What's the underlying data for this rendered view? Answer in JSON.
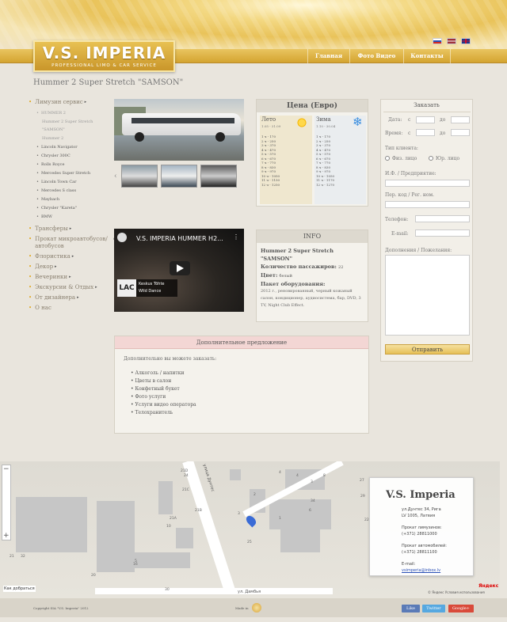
{
  "header": {
    "logo_title": "V.S. IMPERIA",
    "logo_subtitle": "PROFESSIONAL LIMO & CAR SERVICE",
    "nav": [
      "Главная",
      "Фото Видео",
      "Контакты"
    ],
    "languages": [
      "ru",
      "lv",
      "en"
    ]
  },
  "page": {
    "title": "Hummer 2 Super Stretch \"SAMSON\""
  },
  "sidebar": {
    "items": [
      {
        "label": "Лимузин сервис",
        "has_arrow": true
      },
      {
        "label": "Трансферы",
        "has_arrow": true
      },
      {
        "label": "Прокат микроавтобусов/автобусов",
        "has_arrow": true
      },
      {
        "label": "Флористика",
        "has_arrow": true
      },
      {
        "label": "Декор",
        "has_arrow": true
      },
      {
        "label": "Вечеринки",
        "has_arrow": true
      },
      {
        "label": "Экскурсии & Отдых",
        "has_arrow": true
      },
      {
        "label": "От дизайнера",
        "has_arrow": true
      },
      {
        "label": "О нас",
        "has_arrow": false
      }
    ],
    "subitems": [
      {
        "label": "HUMMER 2",
        "active": true
      },
      {
        "label": "Hummer 2 Super Stretch \"SAMSON\"",
        "active": true
      },
      {
        "label": "Hummer 2",
        "active": true
      },
      {
        "label": "Lincoln Navigator",
        "active": false
      },
      {
        "label": "Chrysler 300C",
        "active": false
      },
      {
        "label": "Rolls Royce",
        "active": false
      },
      {
        "label": "Mercedes Super Stretch",
        "active": false
      },
      {
        "label": "Lincoln Town Car",
        "active": false
      },
      {
        "label": "Mercedes S class",
        "active": false
      },
      {
        "label": "Maybach",
        "active": false
      },
      {
        "label": "Chrysler \"Kareta\"",
        "active": false
      },
      {
        "label": "BMW",
        "active": false
      }
    ]
  },
  "prices": {
    "title": "Цена (Евро)",
    "summer": {
      "label": "Лето",
      "period": "1.05 - 31.09",
      "rows": [
        "1 ч - 170",
        "2 ч - 250",
        "3 ч - 370",
        "4 ч - 470",
        "5 ч - 570",
        "6 ч - 670",
        "7 ч - 770",
        "8 ч - 830",
        "9 ч - 970",
        "10 ч - 1050",
        "11 ч - 1150",
        "12 ч - 1250"
      ]
    },
    "winter": {
      "label": "Зима",
      "period": "1.10 - 30.04",
      "rows": [
        "1 ч - 170",
        "2 ч - 250",
        "3 ч - 370",
        "4 ч - 470",
        "5 ч - 570",
        "6 ч - 670",
        "7 ч - 770",
        "8 ч - 830",
        "9 ч - 970",
        "10 ч - 1050",
        "11 ч - 1170",
        "12 ч - 1270"
      ]
    }
  },
  "video": {
    "title": "V.S. IMPERIA HUMMER H2...",
    "overlay_line1": "Keskus Tõhte",
    "overlay_line2": "Wild Dance"
  },
  "info": {
    "title": "INFO",
    "name": "Hummer 2 Super Stretch \"SAMSON\"",
    "passengers_label": "Количество пассажиров:",
    "passengers_value": "22",
    "color_label": "Цвет:",
    "color_value": "белый",
    "equipment_label": "Пакет оборудования:",
    "equipment_value": "2012 г., реновированный, черный кожаный салон, кондиционер, аудиосистема, бар, DVD, 3 TV, Night Club Effect."
  },
  "extra": {
    "title": "Дополнительное предложение",
    "intro": "Дополнительно вы можете заказать:",
    "items": [
      "Алкоголь / напитки",
      "Цветы в салон",
      "Конфетный букет",
      "Фото услуги",
      "Услуги видео оператора",
      "Телохранитель"
    ]
  },
  "order": {
    "title": "Заказать",
    "date_label": "Дата:",
    "from": "с",
    "to": "до",
    "time_label": "Время:",
    "client_type_label": "Тип клиента:",
    "radio_phys": "Физ. лицо",
    "radio_jur": "Юр. лицо",
    "name_label": "И.Ф. / Предприятие:",
    "reg_label": "Пер. код / Рег. ном.",
    "phone_label": "Телефон:",
    "email_label": "E-mail:",
    "wishes_label": "Дополнения / Пожелания:",
    "submit": "Отправить"
  },
  "map": {
    "company": "V.S. Imperia",
    "address1": "ул.Дунтес 34, Рига",
    "address2": "LV 1005, Латвия",
    "rent_limo_label": "Прокат лимузинов:",
    "rent_limo_phone": "(+371) 28811000",
    "rent_car_label": "Прокат автомобилей:",
    "rent_car_phone": "(+371) 28811100",
    "email_label": "E-mail:",
    "email": "vsimperia@inbox.lv",
    "how_to_get": "Как добраться",
    "yandex": "Яндекс",
    "terms": "© Яндекс Условия использования",
    "street1": "улица Дунтес",
    "street2": "ул. Дамбья",
    "labels": [
      "21D",
      "21C",
      "21B",
      "21A",
      "4",
      "2",
      "3",
      "1",
      "34",
      "24",
      "21",
      "20",
      "16",
      "29",
      "22",
      "8",
      "27",
      "4",
      "6",
      "25",
      "30",
      "32",
      "10",
      "5",
      "3"
    ]
  },
  "footer": {
    "copyright": "Copyright SIA \"V.S. Imperia\" 2012",
    "made_in": "Made in",
    "social": [
      "Like",
      "Twitter",
      "Google+"
    ]
  },
  "colors": {
    "accent": "#e0a820",
    "nav": "#d8a838",
    "facebook": "#5b7bb7",
    "twitter": "#56a8e0",
    "google": "#d94a3a"
  }
}
